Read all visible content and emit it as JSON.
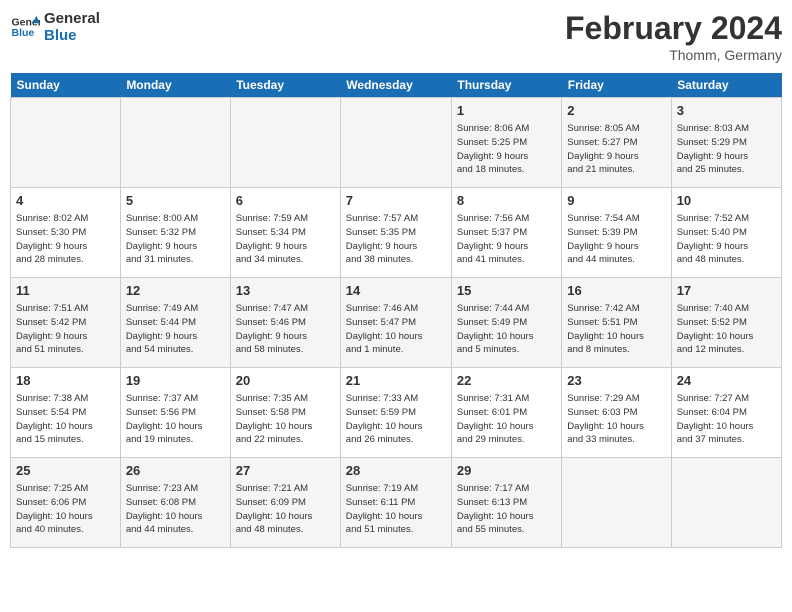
{
  "header": {
    "logo_line1": "General",
    "logo_line2": "Blue",
    "month_title": "February 2024",
    "subtitle": "Thomm, Germany"
  },
  "days_of_week": [
    "Sunday",
    "Monday",
    "Tuesday",
    "Wednesday",
    "Thursday",
    "Friday",
    "Saturday"
  ],
  "weeks": [
    [
      {
        "day": "",
        "info": ""
      },
      {
        "day": "",
        "info": ""
      },
      {
        "day": "",
        "info": ""
      },
      {
        "day": "",
        "info": ""
      },
      {
        "day": "1",
        "info": "Sunrise: 8:06 AM\nSunset: 5:25 PM\nDaylight: 9 hours\nand 18 minutes."
      },
      {
        "day": "2",
        "info": "Sunrise: 8:05 AM\nSunset: 5:27 PM\nDaylight: 9 hours\nand 21 minutes."
      },
      {
        "day": "3",
        "info": "Sunrise: 8:03 AM\nSunset: 5:29 PM\nDaylight: 9 hours\nand 25 minutes."
      }
    ],
    [
      {
        "day": "4",
        "info": "Sunrise: 8:02 AM\nSunset: 5:30 PM\nDaylight: 9 hours\nand 28 minutes."
      },
      {
        "day": "5",
        "info": "Sunrise: 8:00 AM\nSunset: 5:32 PM\nDaylight: 9 hours\nand 31 minutes."
      },
      {
        "day": "6",
        "info": "Sunrise: 7:59 AM\nSunset: 5:34 PM\nDaylight: 9 hours\nand 34 minutes."
      },
      {
        "day": "7",
        "info": "Sunrise: 7:57 AM\nSunset: 5:35 PM\nDaylight: 9 hours\nand 38 minutes."
      },
      {
        "day": "8",
        "info": "Sunrise: 7:56 AM\nSunset: 5:37 PM\nDaylight: 9 hours\nand 41 minutes."
      },
      {
        "day": "9",
        "info": "Sunrise: 7:54 AM\nSunset: 5:39 PM\nDaylight: 9 hours\nand 44 minutes."
      },
      {
        "day": "10",
        "info": "Sunrise: 7:52 AM\nSunset: 5:40 PM\nDaylight: 9 hours\nand 48 minutes."
      }
    ],
    [
      {
        "day": "11",
        "info": "Sunrise: 7:51 AM\nSunset: 5:42 PM\nDaylight: 9 hours\nand 51 minutes."
      },
      {
        "day": "12",
        "info": "Sunrise: 7:49 AM\nSunset: 5:44 PM\nDaylight: 9 hours\nand 54 minutes."
      },
      {
        "day": "13",
        "info": "Sunrise: 7:47 AM\nSunset: 5:46 PM\nDaylight: 9 hours\nand 58 minutes."
      },
      {
        "day": "14",
        "info": "Sunrise: 7:46 AM\nSunset: 5:47 PM\nDaylight: 10 hours\nand 1 minute."
      },
      {
        "day": "15",
        "info": "Sunrise: 7:44 AM\nSunset: 5:49 PM\nDaylight: 10 hours\nand 5 minutes."
      },
      {
        "day": "16",
        "info": "Sunrise: 7:42 AM\nSunset: 5:51 PM\nDaylight: 10 hours\nand 8 minutes."
      },
      {
        "day": "17",
        "info": "Sunrise: 7:40 AM\nSunset: 5:52 PM\nDaylight: 10 hours\nand 12 minutes."
      }
    ],
    [
      {
        "day": "18",
        "info": "Sunrise: 7:38 AM\nSunset: 5:54 PM\nDaylight: 10 hours\nand 15 minutes."
      },
      {
        "day": "19",
        "info": "Sunrise: 7:37 AM\nSunset: 5:56 PM\nDaylight: 10 hours\nand 19 minutes."
      },
      {
        "day": "20",
        "info": "Sunrise: 7:35 AM\nSunset: 5:58 PM\nDaylight: 10 hours\nand 22 minutes."
      },
      {
        "day": "21",
        "info": "Sunrise: 7:33 AM\nSunset: 5:59 PM\nDaylight: 10 hours\nand 26 minutes."
      },
      {
        "day": "22",
        "info": "Sunrise: 7:31 AM\nSunset: 6:01 PM\nDaylight: 10 hours\nand 29 minutes."
      },
      {
        "day": "23",
        "info": "Sunrise: 7:29 AM\nSunset: 6:03 PM\nDaylight: 10 hours\nand 33 minutes."
      },
      {
        "day": "24",
        "info": "Sunrise: 7:27 AM\nSunset: 6:04 PM\nDaylight: 10 hours\nand 37 minutes."
      }
    ],
    [
      {
        "day": "25",
        "info": "Sunrise: 7:25 AM\nSunset: 6:06 PM\nDaylight: 10 hours\nand 40 minutes."
      },
      {
        "day": "26",
        "info": "Sunrise: 7:23 AM\nSunset: 6:08 PM\nDaylight: 10 hours\nand 44 minutes."
      },
      {
        "day": "27",
        "info": "Sunrise: 7:21 AM\nSunset: 6:09 PM\nDaylight: 10 hours\nand 48 minutes."
      },
      {
        "day": "28",
        "info": "Sunrise: 7:19 AM\nSunset: 6:11 PM\nDaylight: 10 hours\nand 51 minutes."
      },
      {
        "day": "29",
        "info": "Sunrise: 7:17 AM\nSunset: 6:13 PM\nDaylight: 10 hours\nand 55 minutes."
      },
      {
        "day": "",
        "info": ""
      },
      {
        "day": "",
        "info": ""
      }
    ]
  ]
}
